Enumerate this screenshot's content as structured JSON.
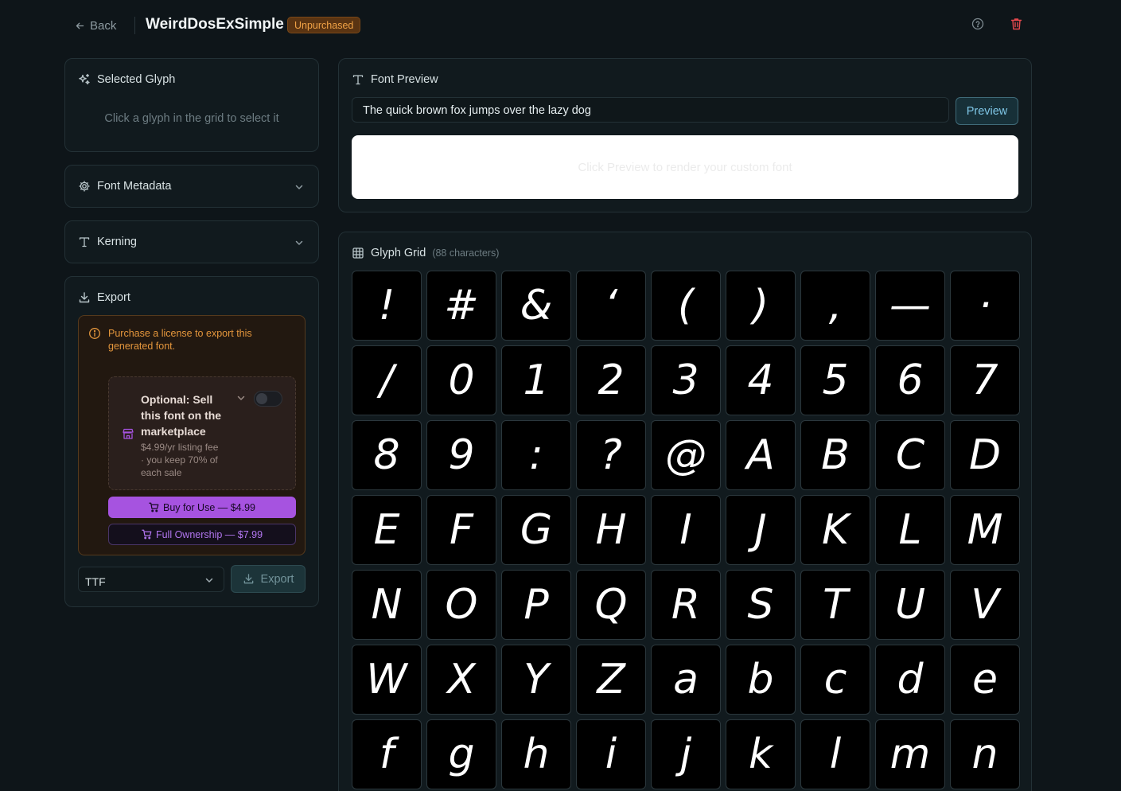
{
  "header": {
    "back_label": "Back",
    "title": "WeirdDosExSimple",
    "badge": "Unpurchased"
  },
  "selected_glyph": {
    "title": "Selected Glyph",
    "hint": "Click a glyph in the grid to select it"
  },
  "font_metadata": {
    "title": "Font Metadata"
  },
  "kerning": {
    "title": "Kerning"
  },
  "export": {
    "title": "Export",
    "warning": "Purchase a license to export this generated font.",
    "sell_title": "Optional: Sell this font on the marketplace",
    "sell_sub": "$4.99/yr listing fee · you keep 70% of each sale",
    "sell_enabled": false,
    "buy_label": "Buy for Use — $4.99",
    "own_label": "Full Ownership — $7.99",
    "format_value": "TTF",
    "export_label": "Export"
  },
  "font_preview": {
    "title": "Font Preview",
    "input_value": "The quick brown fox jumps over the lazy dog",
    "preview_button": "Preview",
    "canvas_text": "Click Preview to render your custom font"
  },
  "glyph_grid": {
    "title": "Glyph Grid",
    "count": "(88 characters)",
    "glyphs": [
      "!",
      "#",
      "&",
      "‘",
      "(",
      ")",
      ",",
      "—",
      "·",
      "/",
      "0",
      "1",
      "2",
      "3",
      "4",
      "5",
      "6",
      "7",
      "8",
      "9",
      ":",
      "?",
      "@",
      "A",
      "B",
      "C",
      "D",
      "E",
      "F",
      "G",
      "H",
      "I",
      "J",
      "K",
      "L",
      "M",
      "N",
      "O",
      "P",
      "Q",
      "R",
      "S",
      "T",
      "U",
      "V",
      "W",
      "X",
      "Y",
      "Z",
      "a",
      "b",
      "c",
      "d",
      "e",
      "f",
      "g",
      "h",
      "i",
      "j",
      "k",
      "l",
      "m",
      "n"
    ]
  },
  "colors": {
    "background": "#0e1519",
    "card": "#111a1e",
    "accent_purple": "#a653e0",
    "warning_orange": "#e4963c",
    "preview_blue": "#7fc6e6"
  }
}
